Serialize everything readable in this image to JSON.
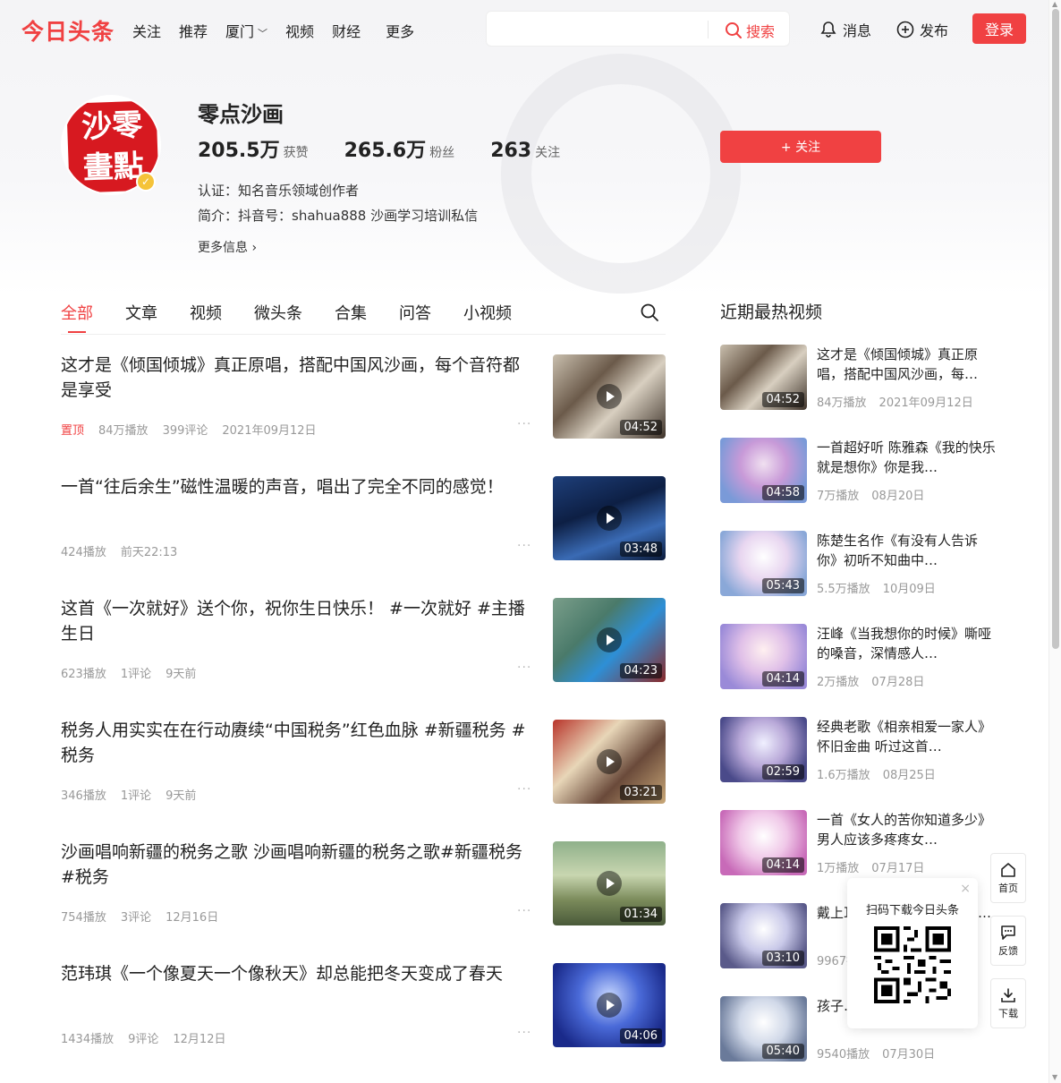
{
  "header": {
    "logo": "今日头条",
    "nav": [
      "关注",
      "推荐",
      "厦门",
      "视频",
      "财经",
      "更多"
    ],
    "search_placeholder": "",
    "search_button": "搜索",
    "messages": "消息",
    "publish": "发布",
    "login": "登录"
  },
  "profile": {
    "name": "零点沙画",
    "avatar_text": "沙零畫點",
    "stats": [
      {
        "num": "205.5万",
        "label": "获赞"
      },
      {
        "num": "265.6万",
        "label": "粉丝"
      },
      {
        "num": "263",
        "label": "关注"
      }
    ],
    "follow_button": "+ 关注",
    "certification": "认证：知名音乐领域创作者",
    "intro": "简介：抖音号：shahua888  沙画学习培训私信",
    "more_info": "更多信息 ›"
  },
  "tabs": [
    "全部",
    "文章",
    "视频",
    "微头条",
    "合集",
    "问答",
    "小视频"
  ],
  "feed": [
    {
      "title": "这才是《倾国倾城》真正原唱，搭配中国风沙画，每个音符都是享受",
      "pin": "置顶",
      "meta": [
        "84万播放",
        "399评论",
        "2021年09月12日"
      ],
      "duration": "04:52"
    },
    {
      "title": "一首“往后余生”磁性温暖的声音，唱出了完全不同的感觉！",
      "pin": "",
      "meta": [
        "424播放",
        "前天22:13"
      ],
      "duration": "03:48"
    },
    {
      "title": "这首《一次就好》送个你，祝你生日快乐！ #一次就好 #主播生日",
      "pin": "",
      "meta": [
        "623播放",
        "1评论",
        "9天前"
      ],
      "duration": "04:23"
    },
    {
      "title": "税务人用实实在在行动赓续“中国税务”红色血脉 #新疆税务 #税务",
      "pin": "",
      "meta": [
        "346播放",
        "1评论",
        "9天前"
      ],
      "duration": "03:21"
    },
    {
      "title": "沙画唱响新疆的税务之歌 沙画唱响新疆的税务之歌#新疆税务 #税务",
      "pin": "",
      "meta": [
        "754播放",
        "3评论",
        "12月16日"
      ],
      "duration": "01:34"
    },
    {
      "title": "范玮琪《一个像夏天一个像秋天》却总能把冬天变成了春天",
      "pin": "",
      "meta": [
        "1434播放",
        "9评论",
        "12月12日"
      ],
      "duration": "04:06"
    }
  ],
  "sidebar": {
    "heading": "近期最热视频",
    "items": [
      {
        "title": "这才是《倾国倾城》真正原唱，搭配中国风沙画，每…",
        "views": "84万播放",
        "date": "2021年09月12日",
        "duration": "04:52"
      },
      {
        "title": "一首超好听 陈雅森《我的快乐就是想你》你是我…",
        "views": "7万播放",
        "date": "08月20日",
        "duration": "04:58"
      },
      {
        "title": "陈楚生名作《有没有人告诉你》初听不知曲中…",
        "views": "5.5万播放",
        "date": "10月09日",
        "duration": "05:43"
      },
      {
        "title": "汪峰《当我想你的时候》嘶哑的嗓音，深情感人…",
        "views": "2万播放",
        "date": "07月28日",
        "duration": "04:14"
      },
      {
        "title": "经典老歌《相亲相爱一家人》怀旧金曲 听过这首…",
        "views": "1.6万播放",
        "date": "08月25日",
        "duration": "02:59"
      },
      {
        "title": "一首《女人的苦你知道多少》男人应该多疼疼女…",
        "views": "1万播放",
        "date": "07月17日",
        "duration": "04:14"
      },
      {
        "title": "戴上耳机，听完这首歌后一…",
        "views": "9967播放",
        "date": "",
        "duration": "03:10"
      },
      {
        "title": "孩子…",
        "views": "9540播放",
        "date": "07月30日",
        "duration": "05:40"
      }
    ]
  },
  "qr_popup": {
    "label": "扫码下载今日头条",
    "close": "×"
  },
  "tools": [
    {
      "label": "首页",
      "icon": "home-icon"
    },
    {
      "label": "反馈",
      "icon": "feedback-icon"
    },
    {
      "label": "下载",
      "icon": "download-icon"
    }
  ],
  "colors": {
    "brand": "#f04142",
    "meta": "#999999"
  }
}
